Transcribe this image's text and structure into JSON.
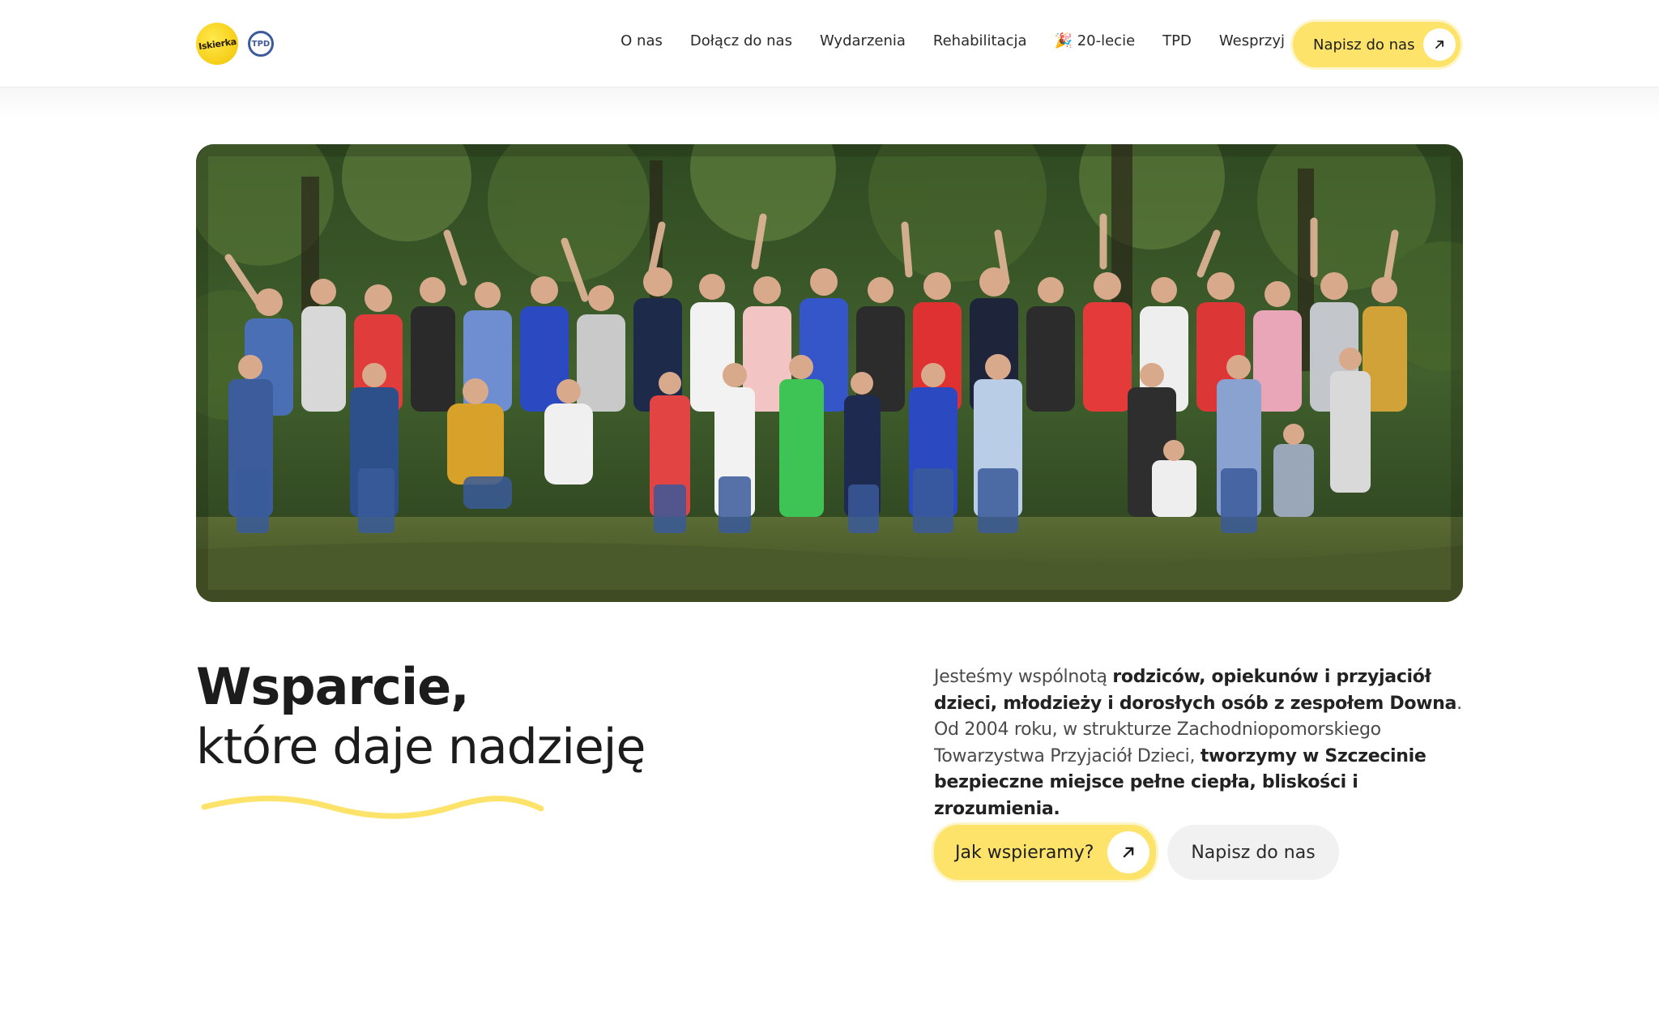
{
  "header": {
    "logo_text": "Iskierka",
    "tpd_logo_text": "TPD",
    "nav": [
      {
        "label": "O nas"
      },
      {
        "label": "Dołącz do nas"
      },
      {
        "label": "Wydarzenia"
      },
      {
        "label": "Rehabilitacja"
      },
      {
        "label": "🎉 20-lecie"
      },
      {
        "label": "TPD"
      },
      {
        "label": "Wesprzyj"
      }
    ],
    "cta_label": "Napisz do nas"
  },
  "hero": {
    "image_alt": "group-photo"
  },
  "headline": {
    "strong": "Wsparcie,",
    "light": "które daje nadzieję"
  },
  "description": {
    "p1": "Jesteśmy wspólnotą ",
    "b1": "rodziców, opiekunów i przyjaciół dzieci, młodzieży i dorosłych osób z zespołem Downa",
    "p2": ". Od 2004 roku, w strukturze Zachodniopomorskiego Towarzystwa Przyjaciół Dzieci, ",
    "b2": "tworzymy w Szczecinie bezpieczne miejsce pełne ciepła, bliskości i zrozumienia."
  },
  "buttons": {
    "primary_label": "Jak wspieramy?",
    "secondary_label": "Napisz do nas"
  },
  "colors": {
    "accent_yellow": "#fde36a",
    "text_dark": "#1c1c1c",
    "secondary_bg": "#f1f1f1"
  }
}
